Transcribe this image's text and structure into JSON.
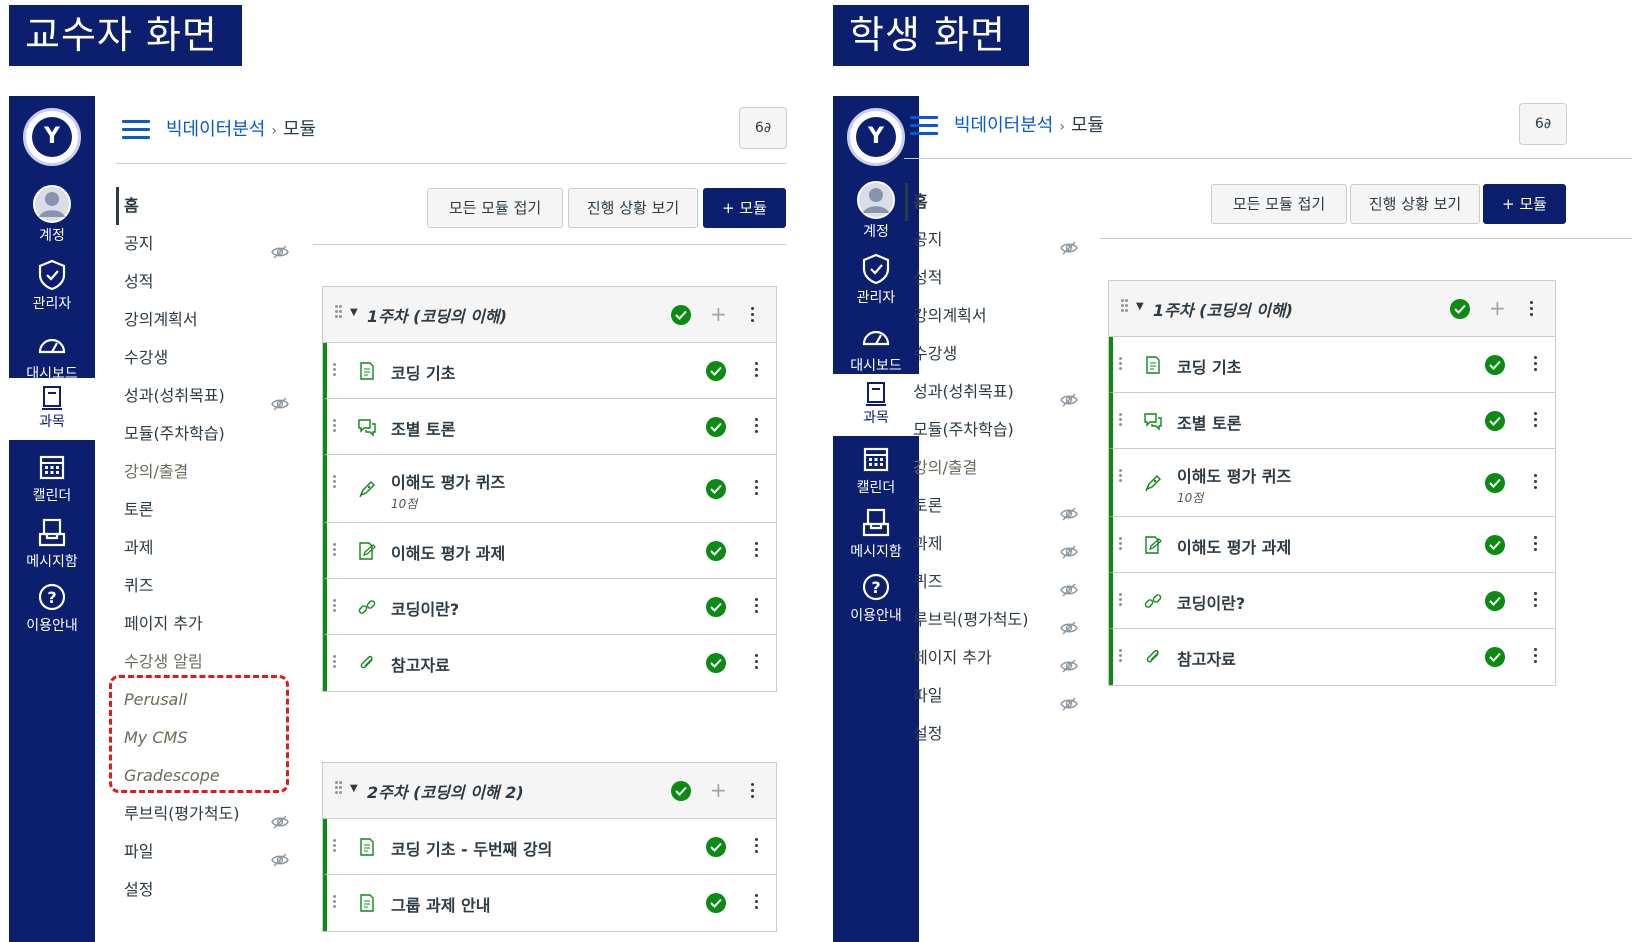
{
  "professor": {
    "title": "교수자 화면",
    "breadcrumb": {
      "course": "빅데이터분석",
      "current": "모듈"
    },
    "global_nav": [
      {
        "label": "계정",
        "icon": "avatar-icon"
      },
      {
        "label": "관리자",
        "icon": "shield-icon"
      },
      {
        "label": "대시보드",
        "icon": "dashboard-gauge-icon"
      },
      {
        "label": "과목",
        "icon": "book-icon",
        "active": true
      },
      {
        "label": "캘린더",
        "icon": "calendar-icon"
      },
      {
        "label": "메시지함",
        "icon": "inbox-icon"
      },
      {
        "label": "이용안내",
        "icon": "help-icon"
      }
    ],
    "course_nav": [
      {
        "label": "홈",
        "active": true
      },
      {
        "label": "공지",
        "hidden": true
      },
      {
        "label": "성적"
      },
      {
        "label": "강의계획서"
      },
      {
        "label": "수강생"
      },
      {
        "label": "성과(성취목표)",
        "hidden": true
      },
      {
        "label": "모듈(주차학습)"
      },
      {
        "label": "강의/출결",
        "muted": true
      },
      {
        "label": "토론"
      },
      {
        "label": "과제"
      },
      {
        "label": "퀴즈"
      },
      {
        "label": "페이지 추가"
      },
      {
        "label": "수강생 알림",
        "muted": true
      },
      {
        "label": "Perusall",
        "ext": true
      },
      {
        "label": "My CMS",
        "ext": true
      },
      {
        "label": "Gradescope",
        "ext": true
      },
      {
        "label": "루브릭(평가척도)",
        "hidden": true
      },
      {
        "label": "파일",
        "hidden": true
      },
      {
        "label": "설정"
      }
    ],
    "toolbar": {
      "collapse_all": "모든 모듈 접기",
      "view_progress": "진행 상황 보기",
      "add_module": "+ 모듈"
    },
    "modules": [
      {
        "title": "1주차 (코딩의 이해)",
        "items": [
          {
            "name": "코딩 기초",
            "type": "page"
          },
          {
            "name": "조별 토론",
            "type": "discussion"
          },
          {
            "name": "이해도 평가 퀴즈",
            "type": "quiz",
            "sub": "10점"
          },
          {
            "name": "이해도 평가 과제",
            "type": "assignment"
          },
          {
            "name": "코딩이란?",
            "type": "link"
          },
          {
            "name": "참고자료",
            "type": "attachment"
          }
        ]
      },
      {
        "title": "2주차 (코딩의 이해 2)",
        "items": [
          {
            "name": "코딩 기초 - 두번째 강의",
            "type": "page"
          },
          {
            "name": "그룹 과제 안내",
            "type": "page"
          }
        ]
      }
    ]
  },
  "student": {
    "title": "학생 화면",
    "breadcrumb": {
      "course": "빅데이터분석",
      "current": "모듈"
    },
    "global_nav": [
      {
        "label": "계정",
        "icon": "avatar-icon"
      },
      {
        "label": "관리자",
        "icon": "shield-icon"
      },
      {
        "label": "대시보드",
        "icon": "dashboard-gauge-icon"
      },
      {
        "label": "과목",
        "icon": "book-icon",
        "active": true
      },
      {
        "label": "캘린더",
        "icon": "calendar-icon"
      },
      {
        "label": "메시지함",
        "icon": "inbox-icon"
      },
      {
        "label": "이용안내",
        "icon": "help-icon"
      }
    ],
    "course_nav": [
      {
        "label": "홈",
        "active": true
      },
      {
        "label": "공지",
        "hidden": true
      },
      {
        "label": "성적"
      },
      {
        "label": "강의계획서"
      },
      {
        "label": "수강생"
      },
      {
        "label": "성과(성취목표)",
        "hidden": true
      },
      {
        "label": "모듈(주차학습)"
      },
      {
        "label": "강의/출결",
        "muted": true
      },
      {
        "label": "토론",
        "hidden": true
      },
      {
        "label": "과제",
        "hidden": true
      },
      {
        "label": "퀴즈",
        "hidden": true
      },
      {
        "label": "루브릭(평가척도)",
        "hidden": true
      },
      {
        "label": "페이지 추가",
        "hidden": true
      },
      {
        "label": "파일",
        "hidden": true
      },
      {
        "label": "설정"
      }
    ],
    "toolbar": {
      "collapse_all": "모든 모듈 접기",
      "view_progress": "진행 상황 보기",
      "add_module": "+ 모듈"
    },
    "modules": [
      {
        "title": "1주차 (코딩의 이해)",
        "items": [
          {
            "name": "코딩 기초",
            "type": "page"
          },
          {
            "name": "조별 토론",
            "type": "discussion"
          },
          {
            "name": "이해도 평가 퀴즈",
            "type": "quiz",
            "sub": "10점"
          },
          {
            "name": "이해도 평가 과제",
            "type": "assignment"
          },
          {
            "name": "코딩이란?",
            "type": "link"
          },
          {
            "name": "참고자료",
            "type": "attachment"
          }
        ]
      }
    ]
  },
  "logo_text": "Y",
  "colors": {
    "brand_navy": "#0c1e6e",
    "link_blue": "#0b57d0",
    "published_green": "#0b8a14",
    "highlight_red": "#e01b1b"
  }
}
